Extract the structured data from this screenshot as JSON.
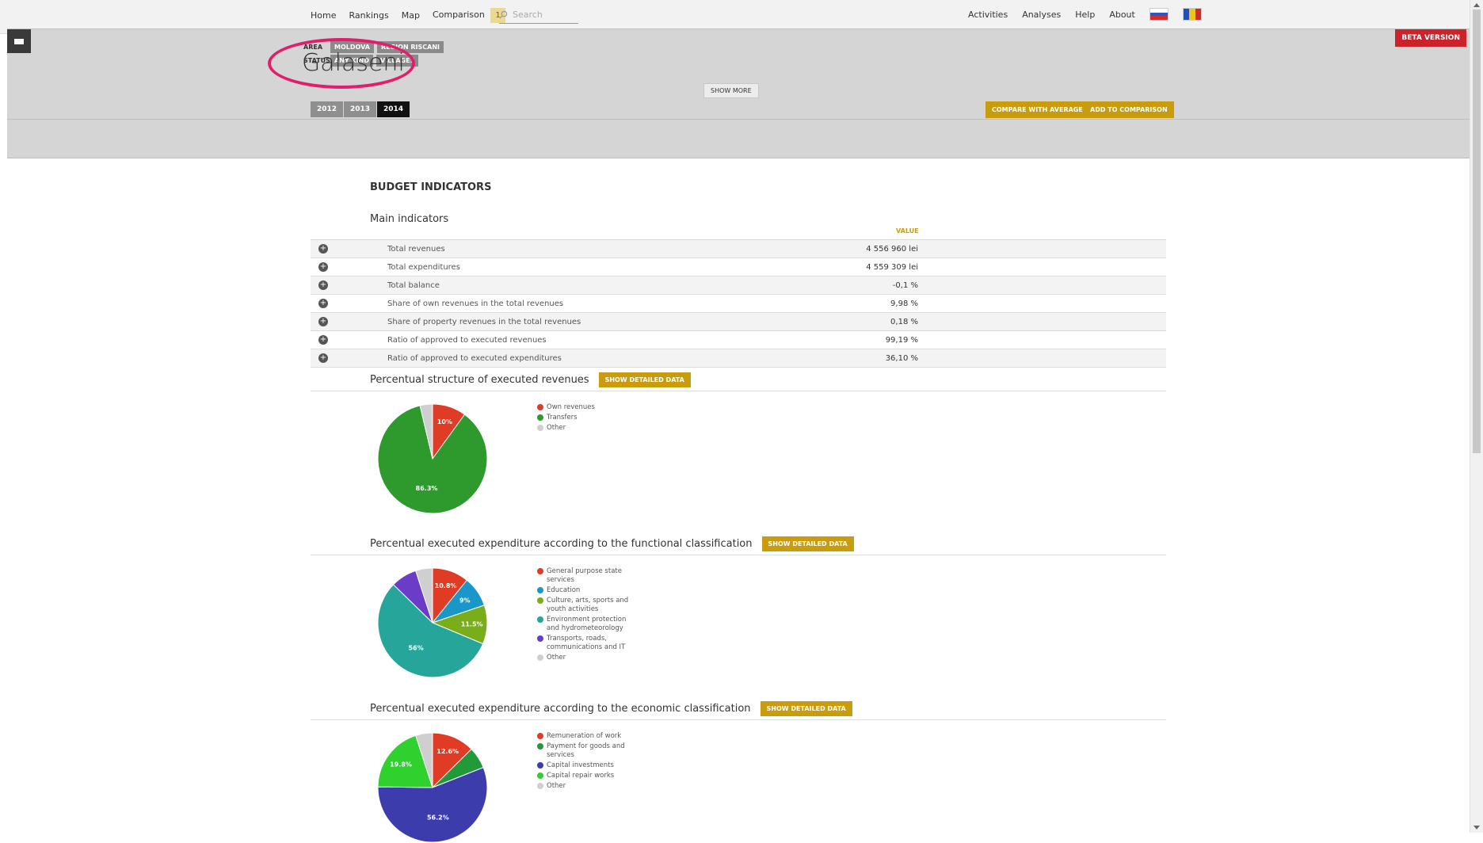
{
  "nav": {
    "left": [
      "Home",
      "Rankings",
      "Map",
      "Comparison"
    ],
    "comparison_count": "1",
    "search_placeholder": "Search",
    "right": [
      "Activities",
      "Analyses",
      "Help",
      "About"
    ]
  },
  "header": {
    "beta": "BETA VERSION",
    "area_label": "AREA",
    "area_pills": [
      "MOLDOVA",
      "REGION RISCANI"
    ],
    "status_label": "STATUS",
    "status_pills": [
      "ANY KIND",
      "VILLAGES"
    ],
    "title": "Galaseni",
    "show_more": "SHOW MORE",
    "years": [
      "2012",
      "2013",
      "2014"
    ],
    "active_year": "2014",
    "compare_avg": "COMPARE WITH AVERAGE",
    "add_comparison": "ADD TO COMPARISON"
  },
  "budget": {
    "title": "BUDGET INDICATORS",
    "main_title": "Main indicators",
    "value_header": "VALUE",
    "rows": [
      {
        "label": "Total revenues",
        "value": "4 556 960 lei"
      },
      {
        "label": "Total expenditures",
        "value": "4 559 309 lei"
      },
      {
        "label": "Total balance",
        "value": "-0,1 %"
      },
      {
        "label": "Share of own revenues in the total revenues",
        "value": "9,98 %"
      },
      {
        "label": "Share of property revenues in the total revenues",
        "value": "0,18 %"
      },
      {
        "label": "Ratio of approved to executed revenues",
        "value": "99,19 %"
      },
      {
        "label": "Ratio of approved to executed expenditures",
        "value": "36,10 %"
      }
    ]
  },
  "detail_button": "SHOW DETAILED DATA",
  "chart_data": [
    {
      "type": "pie",
      "title": "Percentual structure of executed revenues",
      "slices": [
        {
          "label": "Own revenues",
          "value": 10,
          "color": "#e03b24",
          "display": "10%"
        },
        {
          "label": "Transfers",
          "value": 86.3,
          "color": "#2e9a2e",
          "display": "86.3%"
        },
        {
          "label": "Other",
          "value": 3.7,
          "color": "#cfcfcf",
          "display": ""
        }
      ]
    },
    {
      "type": "pie",
      "title": "Percentual executed expenditure according to the functional classification",
      "slices": [
        {
          "label": "General purpose state services",
          "value": 10.8,
          "color": "#e03b24",
          "display": "10.8%"
        },
        {
          "label": "Education",
          "value": 9,
          "color": "#1a97c9",
          "display": "9%"
        },
        {
          "label": "Culture, arts, sports and youth activities",
          "value": 11.5,
          "color": "#79ad19",
          "display": "11.5%"
        },
        {
          "label": "Environment protection and hydrometeorology",
          "value": 56,
          "color": "#26a69a",
          "display": "56%"
        },
        {
          "label": "Transports, roads, communications and IT",
          "value": 7.7,
          "color": "#6a3cc8",
          "display": ""
        },
        {
          "label": "Other",
          "value": 5,
          "color": "#cfcfcf",
          "display": ""
        }
      ]
    },
    {
      "type": "pie",
      "title": "Percentual executed expenditure according to the economic classification",
      "slices": [
        {
          "label": "Remuneration of work",
          "value": 12.6,
          "color": "#e03b24",
          "display": "12.6%"
        },
        {
          "label": "Payment for goods and services",
          "value": 6.4,
          "color": "#229a3a",
          "display": ""
        },
        {
          "label": "Capital investments",
          "value": 56.2,
          "color": "#3c3cad",
          "display": "56.2%"
        },
        {
          "label": "Capital repair works",
          "value": 19.8,
          "color": "#2ed12e",
          "display": "19.8%"
        },
        {
          "label": "Other",
          "value": 5,
          "color": "#cfcfcf",
          "display": ""
        }
      ]
    }
  ]
}
